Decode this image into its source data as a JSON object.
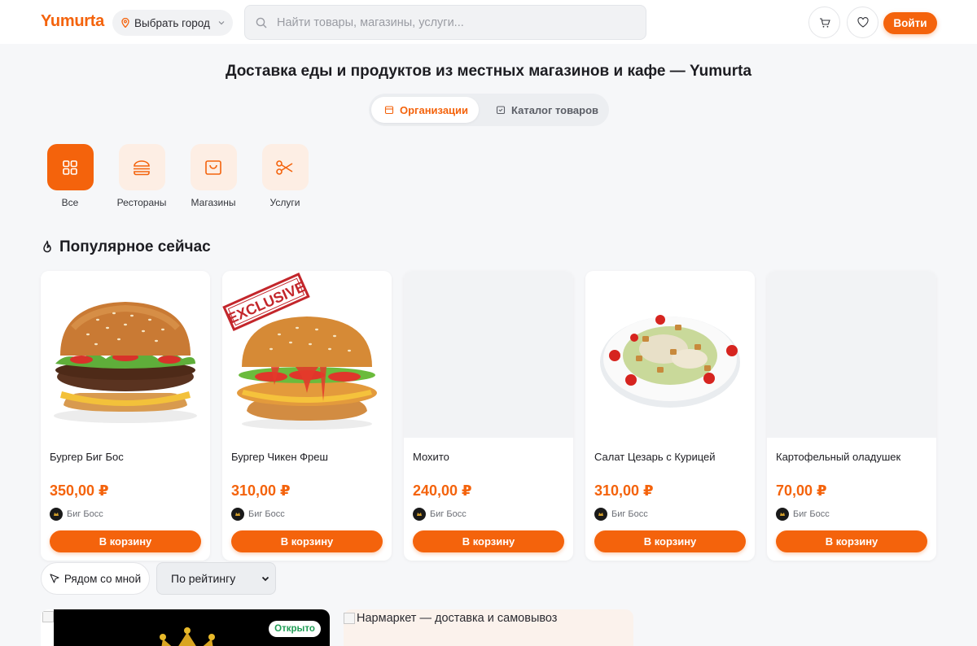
{
  "header": {
    "logo": "Yumurta",
    "city_label": "Выбрать город",
    "search_placeholder": "Найти товары, магазины, услуги...",
    "login_label": "Войти"
  },
  "page_title": "Доставка еды и продуктов из местных магазинов и кафе — Yumurta",
  "tabs": [
    {
      "label": "Организации",
      "active": true
    },
    {
      "label": "Каталог товаров",
      "active": false
    }
  ],
  "categories": [
    {
      "label": "Все",
      "icon": "grid-icon",
      "active": true
    },
    {
      "label": "Рестораны",
      "icon": "burger-icon",
      "active": false
    },
    {
      "label": "Магазины",
      "icon": "shopping-bag-icon",
      "active": false
    },
    {
      "label": "Услуги",
      "icon": "scissors-icon",
      "active": false
    }
  ],
  "popular": {
    "title": "Популярное сейчас",
    "items": [
      {
        "name": "Бургер Биг Бос",
        "price": "350,00 ₽",
        "shop": "Биг Босс",
        "cart_label": "В корзину"
      },
      {
        "name": "Бургер Чикен Фреш",
        "price": "310,00 ₽",
        "shop": "Биг Босс",
        "cart_label": "В корзину",
        "badge": "EXCLUSIVE"
      },
      {
        "name": "Мохито",
        "price": "240,00 ₽",
        "shop": "Биг Босс",
        "cart_label": "В корзину"
      },
      {
        "name": "Салат Цезарь с Курицей",
        "price": "310,00 ₽",
        "shop": "Биг Босс",
        "cart_label": "В корзину"
      },
      {
        "name": "Картофельный оладушек",
        "price": "70,00 ₽",
        "shop": "Биг Босс",
        "cart_label": "В корзину"
      }
    ]
  },
  "filters": {
    "near_me_label": "Рядом со мной",
    "sort_selected": "По рейтингу"
  },
  "shops": [
    {
      "status": "Открыто"
    },
    {
      "image_alt": "Нармаркет — доставка и самовывоз"
    }
  ],
  "colors": {
    "accent": "#f4630c",
    "open": "#1f9d55"
  }
}
